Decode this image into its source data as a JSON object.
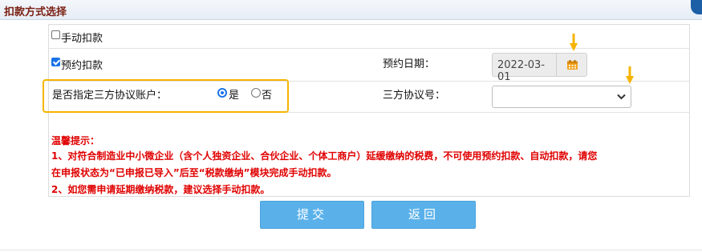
{
  "header": {
    "title": "扣款方式选择"
  },
  "form": {
    "manual_debit_label": "手动扣款",
    "manual_debit_checked": false,
    "scheduled_debit_label": "预约扣款",
    "scheduled_debit_checked": true,
    "schedule_date_label": "预约日期：",
    "schedule_date_value": "2022-03-01",
    "third_party_label": "是否指定三方协议账户：",
    "yes_label": "是",
    "no_label": "否",
    "selected_option": "是",
    "agreement_no_label": "三方协议号：",
    "agreement_no_value": ""
  },
  "tips": {
    "title": "温馨提示：",
    "line1": "1、对符合制造业中小微企业（含个人独资企业、合伙企业、个体工商户）延缓缴纳的税费，不可使用预约扣款、自动扣款，请您",
    "line2": "在申报状态为“已申报已导入”后至“税款缴纳”模块完成手动扣款。",
    "line3": "2、如您需申请延期缴纳税款，建议选择手动扣款。"
  },
  "buttons": {
    "submit": "提交",
    "back": "返回"
  },
  "icons": {
    "date": "calendar-icon",
    "select": "chevron-down-icon",
    "annotation": "arrow-down-icon"
  },
  "colors": {
    "header_text": "#7a1e12",
    "tip_text": "#e00000",
    "button_bg": "#5ab1ea",
    "highlight_border": "#f5b400",
    "checkbox_accent": "#1a73e8"
  }
}
